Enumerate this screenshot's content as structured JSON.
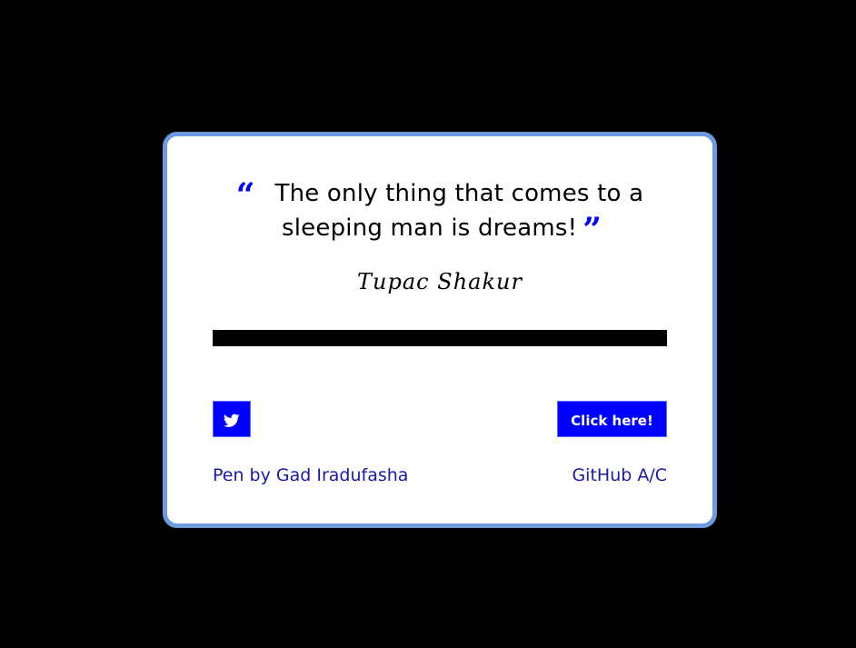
{
  "quote": {
    "text": "The only thing that comes to a sleeping man is dreams!",
    "open_mark": "“",
    "close_mark": "”",
    "author": "Tupac Shakur",
    "open_icon": "quote-left-icon",
    "close_icon": "quote-right-icon"
  },
  "progress": {
    "fill_fraction": 1.0
  },
  "actions": {
    "tweet_icon": "twitter-icon",
    "new_quote_label": "Click here!"
  },
  "footer": {
    "credit_label": "Pen by Gad Iradufasha",
    "github_label": "GitHub A/C"
  },
  "colors": {
    "background": "#000000",
    "card": "#ffffff",
    "card_border": "#6e9be0",
    "accent": "#0000ff",
    "link": "#1a1aa6"
  }
}
